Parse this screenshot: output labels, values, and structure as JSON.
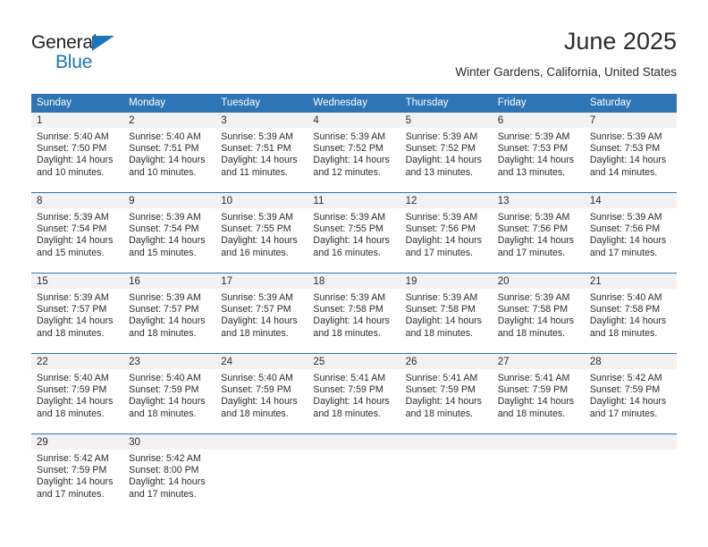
{
  "brand": {
    "name_part1": "General",
    "name_part2": "Blue",
    "accent_color": "#1b75bb"
  },
  "header": {
    "month_title": "June 2025",
    "location": "Winter Gardens, California, United States"
  },
  "theme": {
    "header_blue": "#2e75b6",
    "band_gray": "#f2f2f2",
    "text_color": "#2b2b2b"
  },
  "calendar": {
    "weekday_headers": [
      "Sunday",
      "Monday",
      "Tuesday",
      "Wednesday",
      "Thursday",
      "Friday",
      "Saturday"
    ],
    "weeks": [
      [
        {
          "day": "1",
          "sunrise": "Sunrise: 5:40 AM",
          "sunset": "Sunset: 7:50 PM",
          "daylight_line1": "Daylight: 14 hours",
          "daylight_line2": "and 10 minutes."
        },
        {
          "day": "2",
          "sunrise": "Sunrise: 5:40 AM",
          "sunset": "Sunset: 7:51 PM",
          "daylight_line1": "Daylight: 14 hours",
          "daylight_line2": "and 10 minutes."
        },
        {
          "day": "3",
          "sunrise": "Sunrise: 5:39 AM",
          "sunset": "Sunset: 7:51 PM",
          "daylight_line1": "Daylight: 14 hours",
          "daylight_line2": "and 11 minutes."
        },
        {
          "day": "4",
          "sunrise": "Sunrise: 5:39 AM",
          "sunset": "Sunset: 7:52 PM",
          "daylight_line1": "Daylight: 14 hours",
          "daylight_line2": "and 12 minutes."
        },
        {
          "day": "5",
          "sunrise": "Sunrise: 5:39 AM",
          "sunset": "Sunset: 7:52 PM",
          "daylight_line1": "Daylight: 14 hours",
          "daylight_line2": "and 13 minutes."
        },
        {
          "day": "6",
          "sunrise": "Sunrise: 5:39 AM",
          "sunset": "Sunset: 7:53 PM",
          "daylight_line1": "Daylight: 14 hours",
          "daylight_line2": "and 13 minutes."
        },
        {
          "day": "7",
          "sunrise": "Sunrise: 5:39 AM",
          "sunset": "Sunset: 7:53 PM",
          "daylight_line1": "Daylight: 14 hours",
          "daylight_line2": "and 14 minutes."
        }
      ],
      [
        {
          "day": "8",
          "sunrise": "Sunrise: 5:39 AM",
          "sunset": "Sunset: 7:54 PM",
          "daylight_line1": "Daylight: 14 hours",
          "daylight_line2": "and 15 minutes."
        },
        {
          "day": "9",
          "sunrise": "Sunrise: 5:39 AM",
          "sunset": "Sunset: 7:54 PM",
          "daylight_line1": "Daylight: 14 hours",
          "daylight_line2": "and 15 minutes."
        },
        {
          "day": "10",
          "sunrise": "Sunrise: 5:39 AM",
          "sunset": "Sunset: 7:55 PM",
          "daylight_line1": "Daylight: 14 hours",
          "daylight_line2": "and 16 minutes."
        },
        {
          "day": "11",
          "sunrise": "Sunrise: 5:39 AM",
          "sunset": "Sunset: 7:55 PM",
          "daylight_line1": "Daylight: 14 hours",
          "daylight_line2": "and 16 minutes."
        },
        {
          "day": "12",
          "sunrise": "Sunrise: 5:39 AM",
          "sunset": "Sunset: 7:56 PM",
          "daylight_line1": "Daylight: 14 hours",
          "daylight_line2": "and 17 minutes."
        },
        {
          "day": "13",
          "sunrise": "Sunrise: 5:39 AM",
          "sunset": "Sunset: 7:56 PM",
          "daylight_line1": "Daylight: 14 hours",
          "daylight_line2": "and 17 minutes."
        },
        {
          "day": "14",
          "sunrise": "Sunrise: 5:39 AM",
          "sunset": "Sunset: 7:56 PM",
          "daylight_line1": "Daylight: 14 hours",
          "daylight_line2": "and 17 minutes."
        }
      ],
      [
        {
          "day": "15",
          "sunrise": "Sunrise: 5:39 AM",
          "sunset": "Sunset: 7:57 PM",
          "daylight_line1": "Daylight: 14 hours",
          "daylight_line2": "and 18 minutes."
        },
        {
          "day": "16",
          "sunrise": "Sunrise: 5:39 AM",
          "sunset": "Sunset: 7:57 PM",
          "daylight_line1": "Daylight: 14 hours",
          "daylight_line2": "and 18 minutes."
        },
        {
          "day": "17",
          "sunrise": "Sunrise: 5:39 AM",
          "sunset": "Sunset: 7:57 PM",
          "daylight_line1": "Daylight: 14 hours",
          "daylight_line2": "and 18 minutes."
        },
        {
          "day": "18",
          "sunrise": "Sunrise: 5:39 AM",
          "sunset": "Sunset: 7:58 PM",
          "daylight_line1": "Daylight: 14 hours",
          "daylight_line2": "and 18 minutes."
        },
        {
          "day": "19",
          "sunrise": "Sunrise: 5:39 AM",
          "sunset": "Sunset: 7:58 PM",
          "daylight_line1": "Daylight: 14 hours",
          "daylight_line2": "and 18 minutes."
        },
        {
          "day": "20",
          "sunrise": "Sunrise: 5:39 AM",
          "sunset": "Sunset: 7:58 PM",
          "daylight_line1": "Daylight: 14 hours",
          "daylight_line2": "and 18 minutes."
        },
        {
          "day": "21",
          "sunrise": "Sunrise: 5:40 AM",
          "sunset": "Sunset: 7:58 PM",
          "daylight_line1": "Daylight: 14 hours",
          "daylight_line2": "and 18 minutes."
        }
      ],
      [
        {
          "day": "22",
          "sunrise": "Sunrise: 5:40 AM",
          "sunset": "Sunset: 7:59 PM",
          "daylight_line1": "Daylight: 14 hours",
          "daylight_line2": "and 18 minutes."
        },
        {
          "day": "23",
          "sunrise": "Sunrise: 5:40 AM",
          "sunset": "Sunset: 7:59 PM",
          "daylight_line1": "Daylight: 14 hours",
          "daylight_line2": "and 18 minutes."
        },
        {
          "day": "24",
          "sunrise": "Sunrise: 5:40 AM",
          "sunset": "Sunset: 7:59 PM",
          "daylight_line1": "Daylight: 14 hours",
          "daylight_line2": "and 18 minutes."
        },
        {
          "day": "25",
          "sunrise": "Sunrise: 5:41 AM",
          "sunset": "Sunset: 7:59 PM",
          "daylight_line1": "Daylight: 14 hours",
          "daylight_line2": "and 18 minutes."
        },
        {
          "day": "26",
          "sunrise": "Sunrise: 5:41 AM",
          "sunset": "Sunset: 7:59 PM",
          "daylight_line1": "Daylight: 14 hours",
          "daylight_line2": "and 18 minutes."
        },
        {
          "day": "27",
          "sunrise": "Sunrise: 5:41 AM",
          "sunset": "Sunset: 7:59 PM",
          "daylight_line1": "Daylight: 14 hours",
          "daylight_line2": "and 18 minutes."
        },
        {
          "day": "28",
          "sunrise": "Sunrise: 5:42 AM",
          "sunset": "Sunset: 7:59 PM",
          "daylight_line1": "Daylight: 14 hours",
          "daylight_line2": "and 17 minutes."
        }
      ],
      [
        {
          "day": "29",
          "sunrise": "Sunrise: 5:42 AM",
          "sunset": "Sunset: 7:59 PM",
          "daylight_line1": "Daylight: 14 hours",
          "daylight_line2": "and 17 minutes."
        },
        {
          "day": "30",
          "sunrise": "Sunrise: 5:42 AM",
          "sunset": "Sunset: 8:00 PM",
          "daylight_line1": "Daylight: 14 hours",
          "daylight_line2": "and 17 minutes."
        },
        {
          "day": "",
          "sunrise": "",
          "sunset": "",
          "daylight_line1": "",
          "daylight_line2": ""
        },
        {
          "day": "",
          "sunrise": "",
          "sunset": "",
          "daylight_line1": "",
          "daylight_line2": ""
        },
        {
          "day": "",
          "sunrise": "",
          "sunset": "",
          "daylight_line1": "",
          "daylight_line2": ""
        },
        {
          "day": "",
          "sunrise": "",
          "sunset": "",
          "daylight_line1": "",
          "daylight_line2": ""
        },
        {
          "day": "",
          "sunrise": "",
          "sunset": "",
          "daylight_line1": "",
          "daylight_line2": ""
        }
      ]
    ]
  }
}
